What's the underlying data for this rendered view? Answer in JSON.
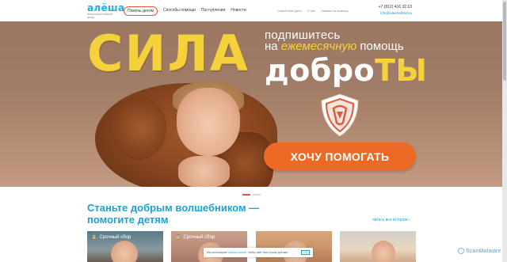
{
  "header": {
    "logo": {
      "word": "алёша",
      "tagline": "благотворительный фонд"
    },
    "help_button": "Помочь детям",
    "nav": [
      "Способы помощи",
      "Поступления",
      "Новости"
    ],
    "subnav": [
      "Спасённые дети",
      "О нас",
      "Заявка на помощь"
    ],
    "phone": "+7 (812) 416 32 63",
    "email": "info@aleshafond.ru"
  },
  "hero": {
    "headline": "СИЛА",
    "subscribe_line1": "подпишитесь",
    "subscribe_line2_prefix": "на ",
    "subscribe_line2_em": "ежемесячную",
    "subscribe_line2_suffix": " помощь",
    "dobro_white": "добро",
    "dobro_yellow": "ТЫ",
    "cta_label": "ХОЧУ ПОМОГАТЬ"
  },
  "section": {
    "title_line1": "Станьте добрым волшебником —",
    "title_line2": "помогите детям",
    "read_all": "читать все истории ›"
  },
  "cards": [
    {
      "tag": "Срочный сбор"
    },
    {
      "tag": "Срочный сбор"
    },
    {
      "tag": ""
    },
    {
      "tag": ""
    }
  ],
  "cookie": {
    "text_prefix": "Мы используем",
    "link": "файлы cookie",
    "text_suffix": "чтобы сайт был лучше для вас",
    "ok": "OK"
  },
  "watermark": "ScanMalware",
  "colors": {
    "accent_blue": "#1f9fd6",
    "cta_orange": "#ec6a25",
    "headline_yellow": "#f5d23b",
    "help_border": "#e8563a"
  }
}
